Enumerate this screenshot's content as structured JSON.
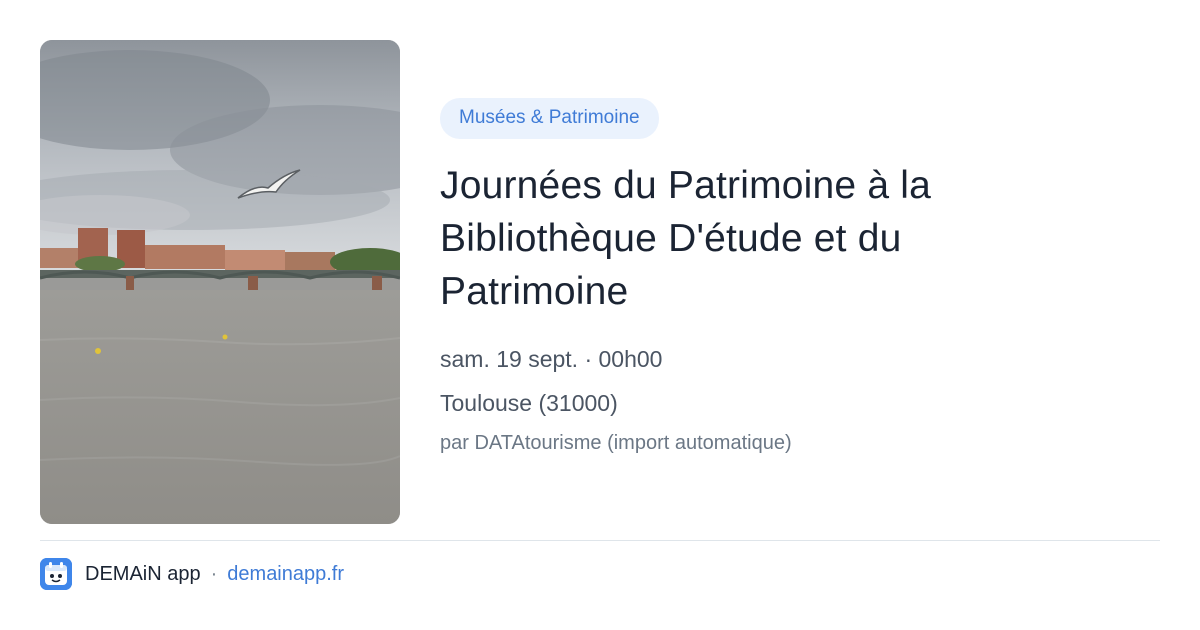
{
  "category": "Musées & Patrimoine",
  "event": {
    "title": "Journées du Patrimoine à la Bibliothèque D'étude et du Patrimoine",
    "datetime": "sam. 19 sept. · 00h00",
    "location": "Toulouse (31000)",
    "source": "par DATAtourisme (import automatique)"
  },
  "footer": {
    "app_name": "DEMAiN app",
    "separator": "·",
    "domain": "demainapp.fr",
    "app_icon": "calendar-face-icon"
  },
  "colors": {
    "accent": "#3f7bd6",
    "badge_bg": "#eaf2fd",
    "title": "#1b2433",
    "muted": "#4b5563"
  }
}
